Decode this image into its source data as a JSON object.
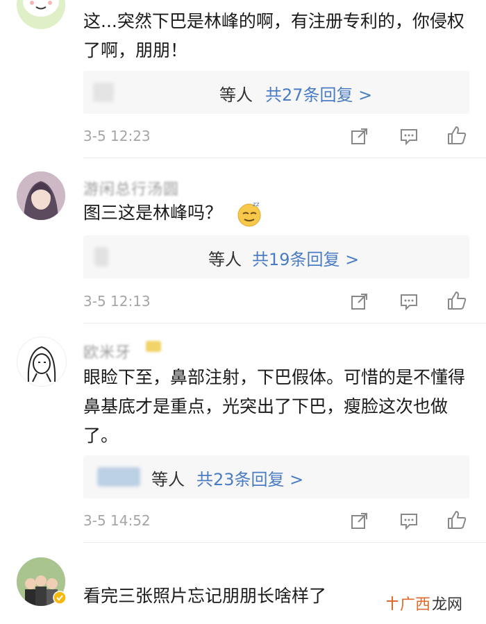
{
  "comments": [
    {
      "username": "",
      "text": "这...突然下巴是林峰的啊，有注册专利的，你侵权了啊，朋朋！",
      "reply_who": "等人",
      "reply_count": "共27条回复 >",
      "time": "3-5 12:23"
    },
    {
      "username": "游闲总行汤圆",
      "text": "图三这是林峰吗？",
      "reply_who": "等人",
      "reply_count": "共19条回复 >",
      "time": "3-5 12:13"
    },
    {
      "username": "欧米牙",
      "text": "眼睑下至，鼻部注射，下巴假体。可惜的是不懂得鼻基底才是重点，光突出了下巴，瘦脸这次也做了。",
      "reply_who": "等人",
      "reply_count": "共23条回复 >",
      "time": "3-5 14:52"
    },
    {
      "username": "",
      "text": "看完三张照片忘记朋朋长啥样了"
    }
  ],
  "watermark": {
    "part1": "广西",
    "part2": "龙网"
  },
  "colors": {
    "link": "#4a7cc4",
    "time": "#a5a5a5",
    "reply_bg": "#f7f7f7"
  }
}
